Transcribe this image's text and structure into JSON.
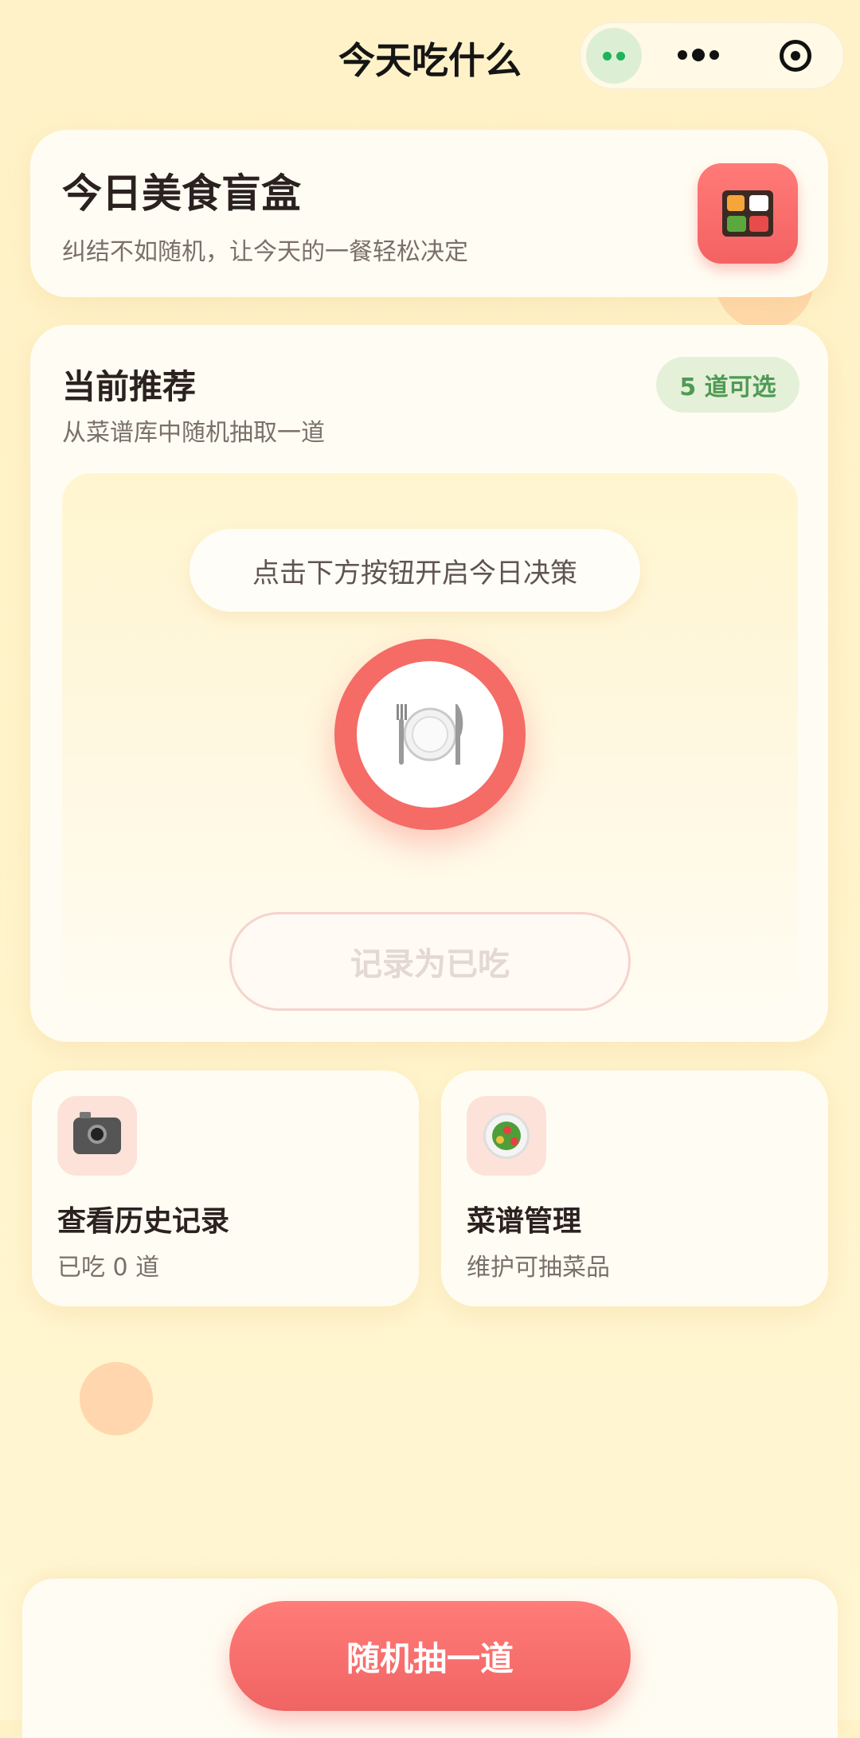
{
  "app": {
    "title": "今天吃什么"
  },
  "header": {
    "title": "今日美食盲盒",
    "subtitle": "纠结不如随机，让今天的一餐轻松决定",
    "icon": "bento-box-icon"
  },
  "recommendation": {
    "title": "当前推荐",
    "subtitle": "从菜谱库中随机抽取一道",
    "count_badge": "5 道可选",
    "hint": "点击下方按钮开启今日决策",
    "plate_icon": "fork-knife-plate-icon",
    "mark_eaten_label": "记录为已吃"
  },
  "tiles": [
    {
      "title": "查看历史记录",
      "subtitle": "已吃 0 道",
      "icon": "camera-icon"
    },
    {
      "title": "菜谱管理",
      "subtitle": "维护可抽菜品",
      "icon": "salad-icon"
    }
  ],
  "bottom": {
    "draw_label": "随机抽一道"
  },
  "colors": {
    "accent": "#f56b66",
    "badge_bg": "#e4f0d8",
    "badge_text": "#4f9a55",
    "background": "#fff2c8"
  }
}
